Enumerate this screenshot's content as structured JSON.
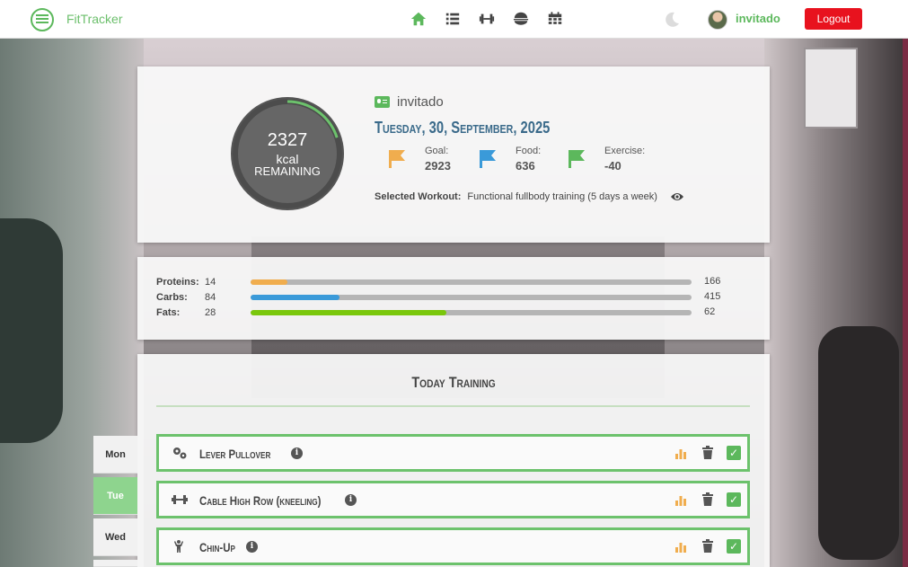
{
  "app": {
    "name": "FitTracker"
  },
  "nav": {
    "icons": [
      "home-icon",
      "list-icon",
      "dumbbell-icon",
      "bowl-icon",
      "calendar-icon"
    ]
  },
  "user": {
    "name": "invitado",
    "logout_label": "Logout"
  },
  "summary": {
    "ring": {
      "value": "2327",
      "unit": "kcal",
      "label": "REMAINING",
      "progress_fraction": 0.2
    },
    "user_name": "invitado",
    "date": "Tuesday, 30, September, 2025",
    "stats": [
      {
        "label": "Goal:",
        "value": "2923",
        "color": "#f0ad4e"
      },
      {
        "label": "Food:",
        "value": "636",
        "color": "#3a9ad9"
      },
      {
        "label": "Exercise:",
        "value": "-40",
        "color": "#5cb85c"
      }
    ],
    "workout_label": "Selected Workout:",
    "workout_value": "Functional fullbody training (5 days a week)"
  },
  "macros": [
    {
      "label": "Proteins:",
      "value": "14",
      "goal": "166",
      "fraction": 0.084,
      "color": "#f0ad4e"
    },
    {
      "label": "Carbs:",
      "value": "84",
      "goal": "415",
      "fraction": 0.202,
      "color": "#3a9ad9"
    },
    {
      "label": "Fats:",
      "value": "28",
      "goal": "62",
      "fraction": 0.445,
      "color": "#7ac70c"
    }
  ],
  "training": {
    "title": "Today Training",
    "exercises": [
      {
        "name": "Lever Pullover",
        "icon": "gears-icon"
      },
      {
        "name": "Cable High Row (kneeling)",
        "icon": "dumbbell-icon"
      },
      {
        "name": "Chin-Up",
        "icon": "person-icon"
      }
    ]
  },
  "days": [
    {
      "label": "Mon",
      "active": false
    },
    {
      "label": "Tue",
      "active": true
    },
    {
      "label": "Wed",
      "active": false
    }
  ],
  "colors": {
    "accent": "#5cb85c",
    "logout": "#e8121e",
    "title_blue": "#3a6a8a"
  }
}
